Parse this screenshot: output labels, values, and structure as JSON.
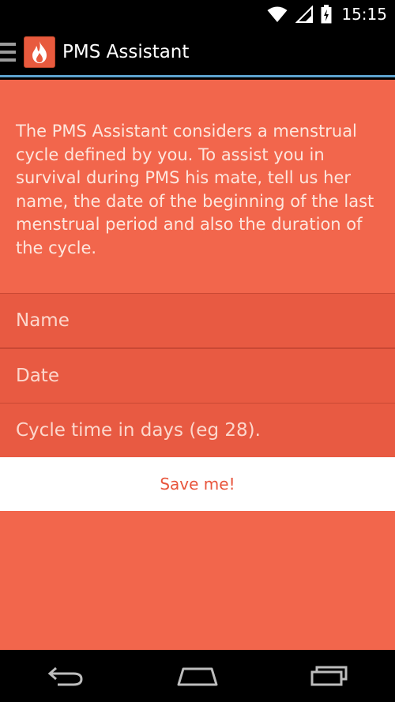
{
  "status_bar": {
    "time": "15:15",
    "icons": [
      "wifi-icon",
      "signal-icon",
      "battery-charging-icon"
    ]
  },
  "action_bar": {
    "title": "PMS Assistant",
    "icons": [
      "drawer-menu-icon",
      "flame-app-icon"
    ]
  },
  "form": {
    "intro": "The PMS Assistant considers a menstrual cycle defined by you. To assist you in survival during PMS his mate, tell us her name, the date of the beginning of the last menstrual period and also the duration of the cycle.",
    "name_placeholder": "Name",
    "date_placeholder": "Date",
    "cycle_placeholder": "Cycle time in days (eg 28).",
    "save_label": "Save me!"
  },
  "nav_bar": {
    "icons": [
      "back-icon",
      "home-icon",
      "recent-apps-icon"
    ]
  },
  "colors": {
    "background": "#f2664c",
    "field": "#e85a42",
    "accent_line": "#5ea3cf",
    "button_text": "#e8553c"
  }
}
